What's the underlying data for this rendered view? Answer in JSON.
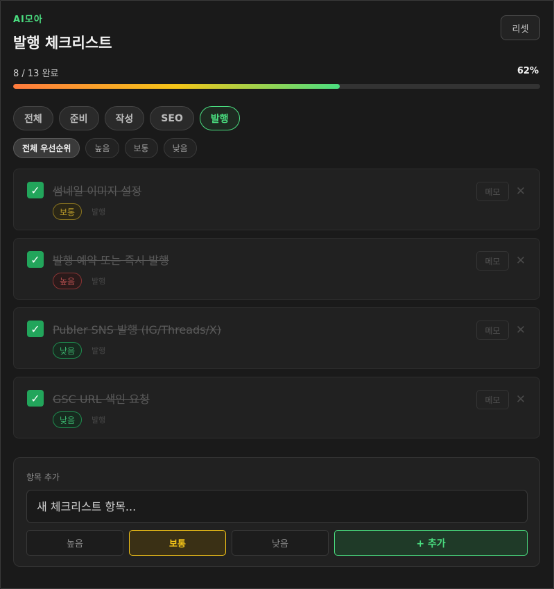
{
  "header": {
    "brand": "AI모아",
    "title": "발행 체크리스트",
    "reset_label": "리셋"
  },
  "progress": {
    "text": "8 / 13 완료",
    "percent_label": "62%",
    "fraction": 0.62
  },
  "tabs": [
    {
      "label": "전체",
      "active": false
    },
    {
      "label": "준비",
      "active": false
    },
    {
      "label": "작성",
      "active": false
    },
    {
      "label": "SEO",
      "active": false
    },
    {
      "label": "발행",
      "active": true
    }
  ],
  "filters": [
    {
      "label": "전체 우선순위",
      "active": true
    },
    {
      "label": "높음",
      "active": false
    },
    {
      "label": "보통",
      "active": false
    },
    {
      "label": "낮음",
      "active": false
    }
  ],
  "items": [
    {
      "text": "썸네일 이미지 설정",
      "priority": "보통",
      "priority_level": "mid",
      "category": "발행",
      "checked": true
    },
    {
      "text": "발행 예약 또는 즉시 발행",
      "priority": "높음",
      "priority_level": "high",
      "category": "발행",
      "checked": true
    },
    {
      "text": "Publer SNS 발행 (IG/Threads/X)",
      "priority": "낮음",
      "priority_level": "low",
      "category": "발행",
      "checked": true
    },
    {
      "text": "GSC URL 색인 요청",
      "priority": "낮음",
      "priority_level": "low",
      "category": "발행",
      "checked": true
    }
  ],
  "item_actions": {
    "memo_label": "메모",
    "delete_glyph": "✕",
    "check_glyph": "✓"
  },
  "add_panel": {
    "label": "항목 추가",
    "placeholder": "새 체크리스트 항목...",
    "priorities": [
      {
        "label": "높음",
        "active": false
      },
      {
        "label": "보통",
        "active": true
      },
      {
        "label": "낮음",
        "active": false
      }
    ],
    "add_label": "+ 추가"
  },
  "colors": {
    "accent": "#4ade80",
    "mid": "#f5c518",
    "high": "#b85050"
  }
}
